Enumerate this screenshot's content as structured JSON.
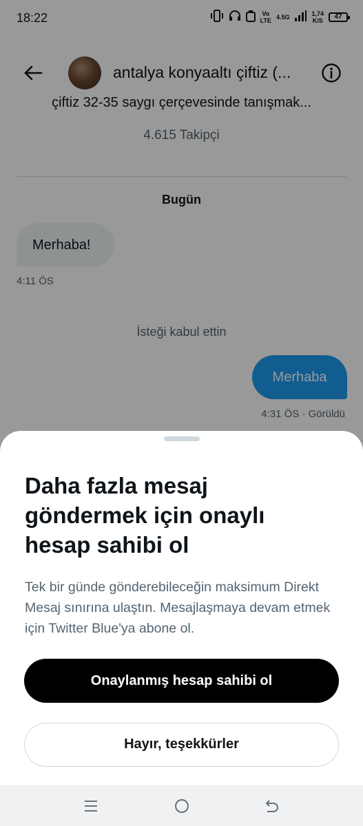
{
  "status_bar": {
    "time": "18:22",
    "volte": "Vo",
    "lte": "LTE",
    "network": "4.5G",
    "speed_value": "1,74",
    "speed_unit": "K/S",
    "battery": "47"
  },
  "header": {
    "title": "antalya konyaaltı çiftiz (...",
    "bio": "çiftiz 32-35 saygı çerçevesinde tanışmak...",
    "followers": "4.615 Takipçi"
  },
  "conversation": {
    "date_label": "Bugün",
    "incoming": {
      "text": "Merhaba!",
      "time": "4:11 ÖS"
    },
    "system_message": "İsteği kabul ettin",
    "outgoing": {
      "text": "Merhaba",
      "status": "4:31 ÖS · Görüldü"
    }
  },
  "sheet": {
    "title": "Daha fazla mesaj göndermek için onaylı hesap sahibi ol",
    "body": "Tek bir günde gönderebileceğin maksimum Direkt Mesaj sınırına ulaştın. Mesajlaşmaya devam etmek için Twitter Blue'ya abone ol.",
    "primary_button": "Onaylanmış hesap sahibi ol",
    "secondary_button": "Hayır, teşekkürler"
  },
  "icons": {
    "back": "arrow-left-icon",
    "info": "info-icon",
    "menu": "menu-icon",
    "home": "home-circle-icon",
    "back_nav": "back-nav-icon"
  },
  "colors": {
    "accent": "#1d9bf0",
    "primary_button": "#000000",
    "secondary_text": "#536471"
  }
}
